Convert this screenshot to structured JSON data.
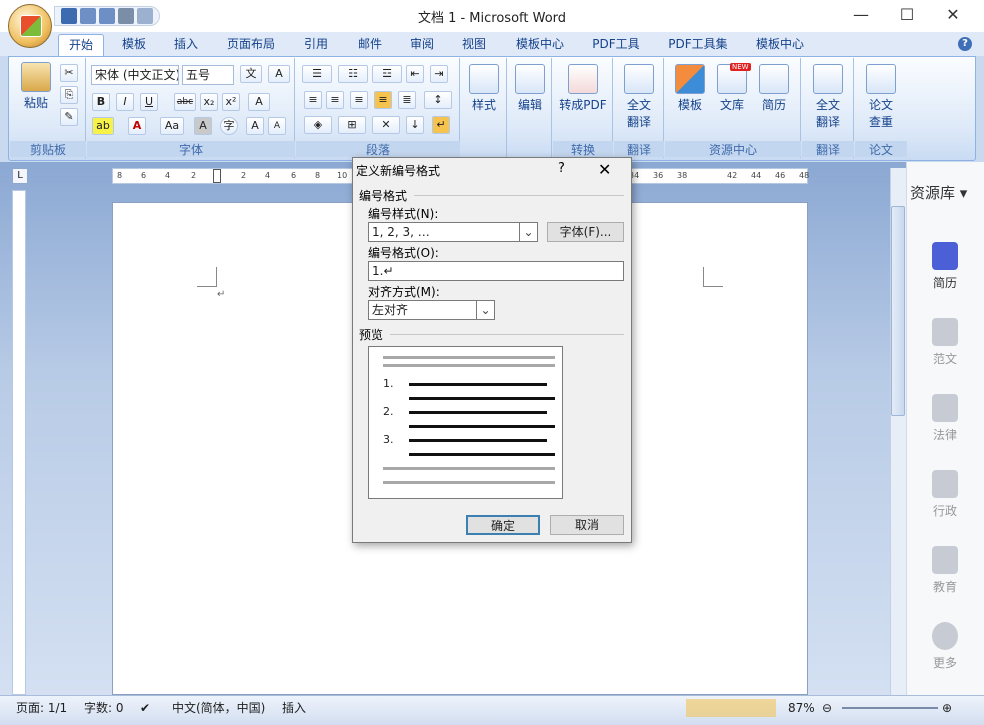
{
  "window": {
    "title": "文档 1 - Microsoft Word",
    "minimize": "—",
    "maximize": "☐",
    "close": "✕"
  },
  "tabs": [
    "开始",
    "模板",
    "插入",
    "页面布局",
    "引用",
    "邮件",
    "审阅",
    "视图",
    "模板中心",
    "PDF工具",
    "PDF工具集",
    "模板中心"
  ],
  "ribbon": {
    "clipboard": {
      "paste": "粘贴",
      "label": "剪贴板"
    },
    "font": {
      "name": "宋体 (中文正文)",
      "size": "五号",
      "label": "字体"
    },
    "paragraph": {
      "label": "段落"
    },
    "styles": {
      "styles": "样式",
      "edit": "编辑"
    },
    "convert": {
      "to_pdf": "转成PDF",
      "label": "转换"
    },
    "translate1": {
      "full": "全文翻译",
      "label": "翻译"
    },
    "resource": {
      "template": "模板",
      "library": "文库",
      "resume": "简历",
      "label": "资源中心",
      "new_badge": "NEW"
    },
    "translate2": {
      "full": "全文翻译",
      "label": "翻译"
    },
    "paper": {
      "check": "论文查重",
      "label": "论文"
    }
  },
  "ruler_ticks": [
    "8",
    "6",
    "4",
    "2",
    "2",
    "4",
    "6",
    "8",
    "10",
    "34",
    "36",
    "38",
    "42",
    "44",
    "46",
    "48"
  ],
  "side_panel": {
    "title": "资源库",
    "items": [
      {
        "label": "简历",
        "active": true
      },
      {
        "label": "范文",
        "active": false
      },
      {
        "label": "法律",
        "active": false
      },
      {
        "label": "行政",
        "active": false
      },
      {
        "label": "教育",
        "active": false
      },
      {
        "label": "更多",
        "active": false
      }
    ]
  },
  "dialog": {
    "title": "定义新编号格式",
    "help": "?",
    "close": "✕",
    "section_format": "编号格式",
    "style_label": "编号样式(N):",
    "style_value": "1, 2, 3, …",
    "font_button": "字体(F)...",
    "format_label": "编号格式(O):",
    "format_value": "1.↵",
    "align_label": "对齐方式(M):",
    "align_value": "左对齐",
    "preview_label": "预览",
    "preview_numbers": [
      "1.",
      "2.",
      "3."
    ],
    "ok": "确定",
    "cancel": "取消"
  },
  "status": {
    "page": "页面: 1/1",
    "words": "字数: 0",
    "lang": "中文(简体，中国)",
    "mode": "插入",
    "zoom": "87%"
  },
  "colors": {
    "accent": "#15428b",
    "ribbon_border": "#8db2e3",
    "side_active": "#4b5fd6"
  }
}
